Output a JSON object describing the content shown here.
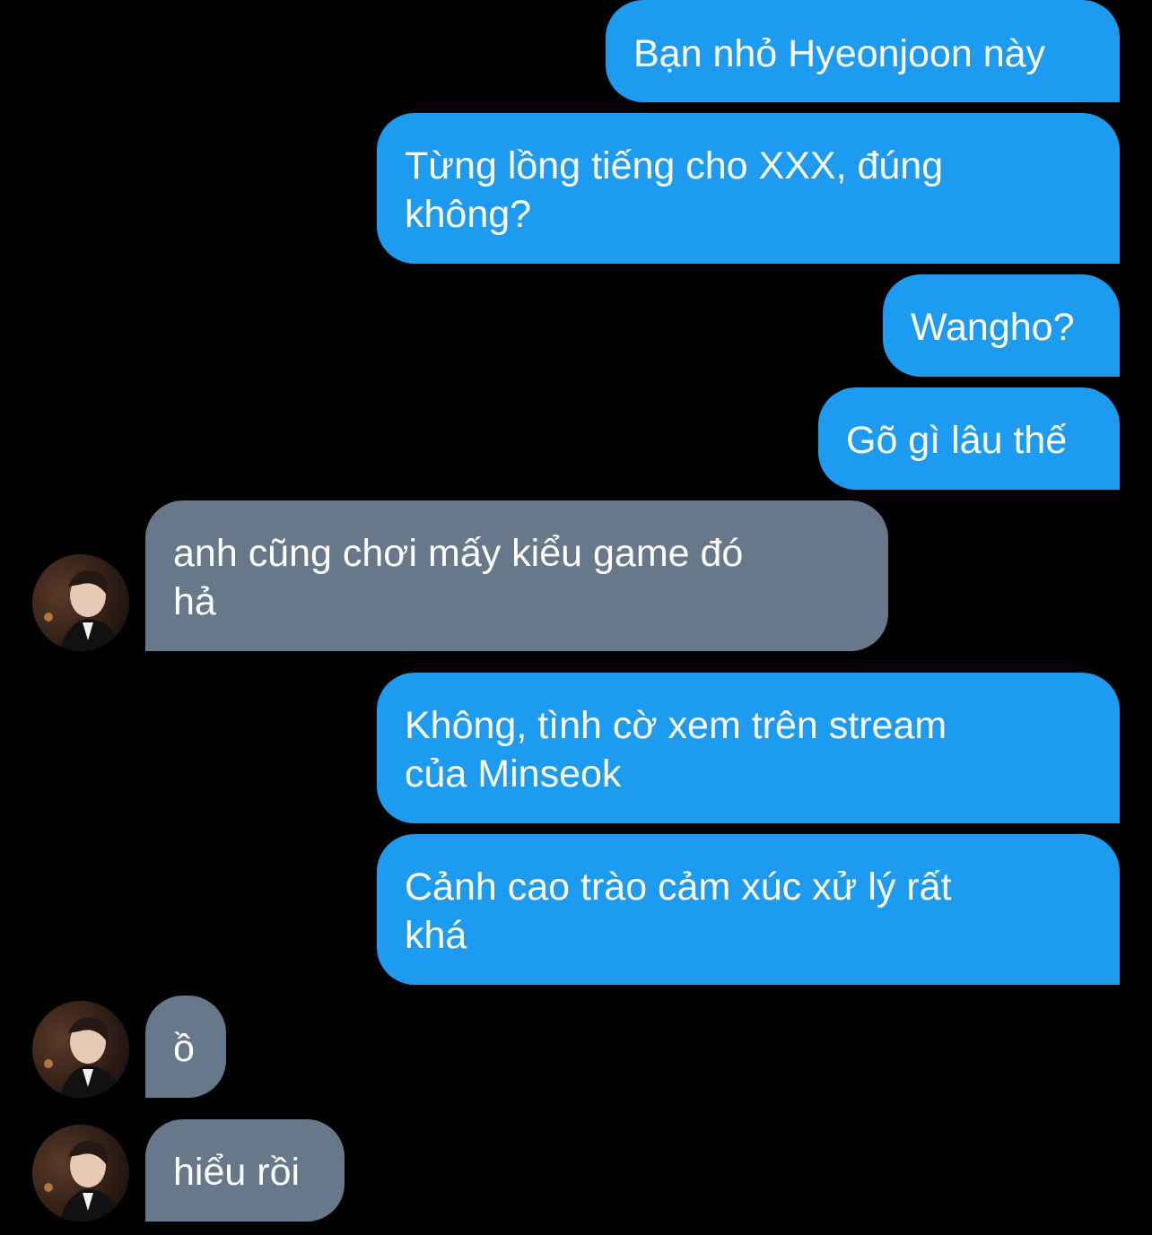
{
  "conversation": {
    "messages": [
      {
        "sender": "me",
        "text": "Bạn nhỏ Hyeonjoon này"
      },
      {
        "sender": "me",
        "text": "Từng lồng tiếng cho XXX, đúng\nkhông?"
      },
      {
        "sender": "me",
        "text": "Wangho?"
      },
      {
        "sender": "me",
        "text": "Gõ gì lâu thế"
      },
      {
        "sender": "contact",
        "text": "anh cũng chơi mấy kiểu game đó\nhả"
      },
      {
        "sender": "me",
        "text": "Không, tình cờ xem trên stream\ncủa Minseok"
      },
      {
        "sender": "me",
        "text": "Cảnh cao trào cảm xúc xử lý rất\nkhá"
      },
      {
        "sender": "contact",
        "text": "ồ"
      },
      {
        "sender": "contact",
        "text": "hiểu rồi"
      }
    ]
  },
  "colors": {
    "background": "#000000",
    "outgoing_bubble": "#1d9bf0",
    "incoming_bubble": "#667889",
    "text": "#ffffff"
  },
  "icons": {
    "contact_avatar": "profile-photo"
  }
}
